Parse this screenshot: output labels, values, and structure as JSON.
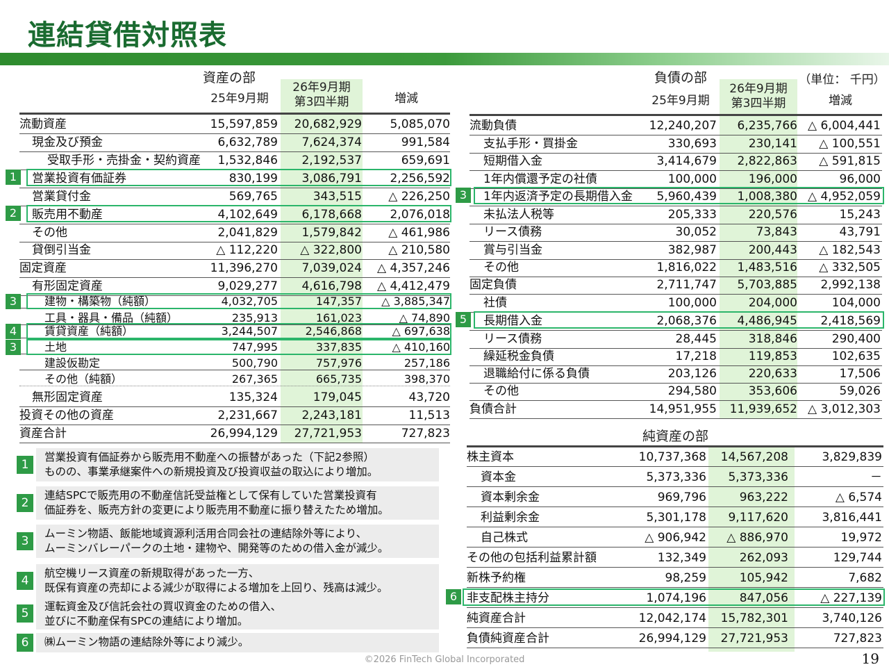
{
  "title": "連結貸借対照表",
  "unit": "（単位： 千円）",
  "footer": "©2026 FinTech Global Incorporated",
  "page": "19",
  "assets": {
    "section": "資産の部",
    "col1": "25年9月期",
    "col2": "26年9月期\n第3四半期",
    "col3": "増減",
    "rows": [
      {
        "label": "流動資産",
        "a": "15,597,859",
        "b": "20,682,929",
        "c": "5,085,070",
        "indent": 0
      },
      {
        "label": "現金及び預金",
        "a": "6,632,789",
        "b": "7,624,374",
        "c": "991,584",
        "indent": 1
      },
      {
        "label": "受取手形・売掛金・契約資産",
        "a": "1,532,846",
        "b": "2,192,537",
        "c": "659,691",
        "indent": 1
      },
      {
        "label": "営業投資有価証券",
        "a": "830,199",
        "b": "3,086,791",
        "c": "2,256,592",
        "indent": 1,
        "badge": "1"
      },
      {
        "label": "営業貸付金",
        "a": "569,765",
        "b": "343,515",
        "c": "△ 226,250",
        "indent": 1
      },
      {
        "label": "販売用不動産",
        "a": "4,102,649",
        "b": "6,178,668",
        "c": "2,076,018",
        "indent": 1,
        "badge": "2"
      },
      {
        "label": "その他",
        "a": "2,041,829",
        "b": "1,579,842",
        "c": "△ 461,986",
        "indent": 1
      },
      {
        "label": "貸倒引当金",
        "a": "△ 112,220",
        "b": "△ 322,800",
        "c": "△ 210,580",
        "indent": 1
      },
      {
        "label": "固定資産",
        "a": "11,396,270",
        "b": "7,039,024",
        "c": "△ 4,357,246",
        "indent": 0
      },
      {
        "label": "有形固定資産",
        "a": "9,029,277",
        "b": "4,616,798",
        "c": "△ 4,412,479",
        "indent": 1
      },
      {
        "label": "建物・構築物（純額）",
        "a": "4,032,705",
        "b": "147,357",
        "c": "△ 3,885,347",
        "indent": 2,
        "badge": "3"
      },
      {
        "label": "工具・器具・備品（純額）",
        "a": "235,913",
        "b": "161,023",
        "c": "△ 74,890",
        "indent": 2
      },
      {
        "label": "賃貸資産（純額）",
        "a": "3,244,507",
        "b": "2,546,868",
        "c": "△ 697,638",
        "indent": 2,
        "badge": "4"
      },
      {
        "label": "土地",
        "a": "747,995",
        "b": "337,835",
        "c": "△ 410,160",
        "indent": 2,
        "badge": "3"
      },
      {
        "label": "建設仮勘定",
        "a": "500,790",
        "b": "757,976",
        "c": "257,186",
        "indent": 2
      },
      {
        "label": "その他（純額）",
        "a": "267,365",
        "b": "665,735",
        "c": "398,370",
        "indent": 2
      },
      {
        "label": "無形固定資産",
        "a": "135,324",
        "b": "179,045",
        "c": "43,720",
        "indent": 1
      },
      {
        "label": "投資その他の資産",
        "a": "2,231,667",
        "b": "2,243,181",
        "c": "11,513",
        "indent": 0
      },
      {
        "label": "資産合計",
        "a": "26,994,129",
        "b": "27,721,953",
        "c": "727,823",
        "indent": 0
      }
    ]
  },
  "liabilities": {
    "section": "負債の部",
    "col1": "25年9月期",
    "col2": "26年9月期\n第3四半期",
    "col3": "増減",
    "rows": [
      {
        "label": "流動負債",
        "a": "12,240,207",
        "b": "6,235,766",
        "c": "△ 6,004,441",
        "indent": 0
      },
      {
        "label": "支払手形・買掛金",
        "a": "330,693",
        "b": "230,141",
        "c": "△ 100,551",
        "indent": 1
      },
      {
        "label": "短期借入金",
        "a": "3,414,679",
        "b": "2,822,863",
        "c": "△ 591,815",
        "indent": 1
      },
      {
        "label": "1年内償還予定の社債",
        "a": "100,000",
        "b": "196,000",
        "c": "96,000",
        "indent": 1
      },
      {
        "label": "1年内返済予定の長期借入金",
        "a": "5,960,439",
        "b": "1,008,380",
        "c": "△ 4,952,059",
        "indent": 1,
        "badge": "3"
      },
      {
        "label": "未払法人税等",
        "a": "205,333",
        "b": "220,576",
        "c": "15,243",
        "indent": 1
      },
      {
        "label": "リース債務",
        "a": "30,052",
        "b": "73,843",
        "c": "43,791",
        "indent": 1
      },
      {
        "label": "賞与引当金",
        "a": "382,987",
        "b": "200,443",
        "c": "△ 182,543",
        "indent": 1
      },
      {
        "label": "その他",
        "a": "1,816,022",
        "b": "1,483,516",
        "c": "△ 332,505",
        "indent": 1
      },
      {
        "label": "固定負債",
        "a": "2,711,747",
        "b": "5,703,885",
        "c": "2,992,138",
        "indent": 0
      },
      {
        "label": "社債",
        "a": "100,000",
        "b": "204,000",
        "c": "104,000",
        "indent": 1
      },
      {
        "label": "長期借入金",
        "a": "2,068,376",
        "b": "4,486,945",
        "c": "2,418,569",
        "indent": 1,
        "badge": "5"
      },
      {
        "label": "リース債務",
        "a": "28,445",
        "b": "318,846",
        "c": "290,400",
        "indent": 1
      },
      {
        "label": "繰延税金負債",
        "a": "17,218",
        "b": "119,853",
        "c": "102,635",
        "indent": 1
      },
      {
        "label": "退職給付に係る負債",
        "a": "203,126",
        "b": "220,633",
        "c": "17,506",
        "indent": 1
      },
      {
        "label": "その他",
        "a": "294,580",
        "b": "353,606",
        "c": "59,026",
        "indent": 1
      },
      {
        "label": "負債合計",
        "a": "14,951,955",
        "b": "11,939,652",
        "c": "△ 3,012,303",
        "indent": 0
      }
    ]
  },
  "equity": {
    "section": "純資産の部",
    "rows": [
      {
        "label": "株主資本",
        "a": "10,737,368",
        "b": "14,567,208",
        "c": "3,829,839",
        "indent": 0
      },
      {
        "label": "資本金",
        "a": "5,373,336",
        "b": "5,373,336",
        "c": "－",
        "indent": 1
      },
      {
        "label": "資本剰余金",
        "a": "969,796",
        "b": "963,222",
        "c": "△ 6,574",
        "indent": 1
      },
      {
        "label": "利益剰余金",
        "a": "5,301,178",
        "b": "9,117,620",
        "c": "3,816,441",
        "indent": 1
      },
      {
        "label": "自己株式",
        "a": "△ 906,942",
        "b": "△ 886,970",
        "c": "19,972",
        "indent": 1
      },
      {
        "label": "その他の包括利益累計額",
        "a": "132,349",
        "b": "262,093",
        "c": "129,744",
        "indent": 0
      },
      {
        "label": "新株予約権",
        "a": "98,259",
        "b": "105,942",
        "c": "7,682",
        "indent": 0
      },
      {
        "label": "非支配株主持分",
        "a": "1,074,196",
        "b": "847,056",
        "c": "△ 227,139",
        "indent": 0,
        "badge": "6"
      },
      {
        "label": "純資産合計",
        "a": "12,042,174",
        "b": "15,782,301",
        "c": "3,740,126",
        "indent": 0
      },
      {
        "label": "負債純資産合計",
        "a": "26,994,129",
        "b": "27,721,953",
        "c": "727,823",
        "indent": 0
      }
    ]
  },
  "notes": [
    {
      "num": "1",
      "text": "営業投資有価証券から販売用不動産への振替があった（下記2参照）\nものの、事業承継案件への新規投資及び投資収益の取込により増加。"
    },
    {
      "num": "2",
      "text": "連結SPCで販売用の不動産信託受益権として保有していた営業投資有\n価証券を、販売方針の変更により販売用不動産に振り替えたため増加。"
    },
    {
      "num": "3",
      "text": "ムーミン物語、飯能地域資源利活用合同会社の連結除外等により、\nムーミンバレーパークの土地・建物や、開発等のための借入金が減少。"
    },
    {
      "num": "4",
      "text": "航空機リース資産の新規取得があった一方、\n既保有資産の売却による減少が取得による増加を上回り、残高は減少。"
    },
    {
      "num": "5",
      "text": "運転資金及び信託会社の買収資金のための借入、\n並びに不動産保有SPCの連結により増加。"
    },
    {
      "num": "6",
      "text": "㈱ムーミン物語の連結除外等により減少。"
    }
  ]
}
